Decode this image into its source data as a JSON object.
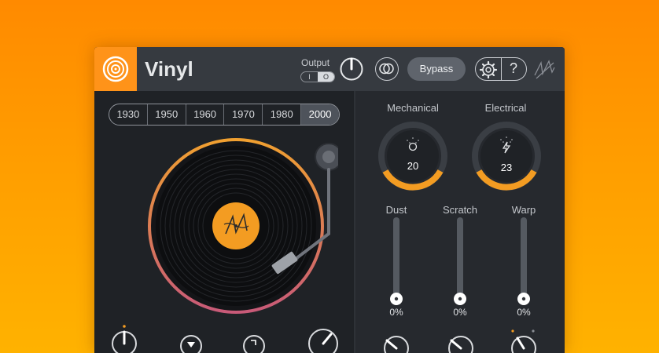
{
  "header": {
    "title": "Vinyl",
    "output_label": "Output",
    "output_options": [
      "I",
      "O"
    ],
    "bypass_label": "Bypass",
    "help_label": "?"
  },
  "years": {
    "items": [
      "1930",
      "1950",
      "1960",
      "1970",
      "1980",
      "2000"
    ],
    "selected": "2000"
  },
  "noise": {
    "mechanical": {
      "label": "Mechanical",
      "value": "20",
      "icon": "gear-icon"
    },
    "electrical": {
      "label": "Electrical",
      "value": "23",
      "icon": "lightning-icon"
    }
  },
  "sliders": [
    {
      "label": "Dust",
      "value": "0%"
    },
    {
      "label": "Scratch",
      "value": "0%"
    },
    {
      "label": "Warp",
      "value": "0%"
    }
  ],
  "colors": {
    "accent": "#ff9319",
    "ring_gradient_start": "#f0a030",
    "ring_gradient_end": "#c85a78"
  }
}
